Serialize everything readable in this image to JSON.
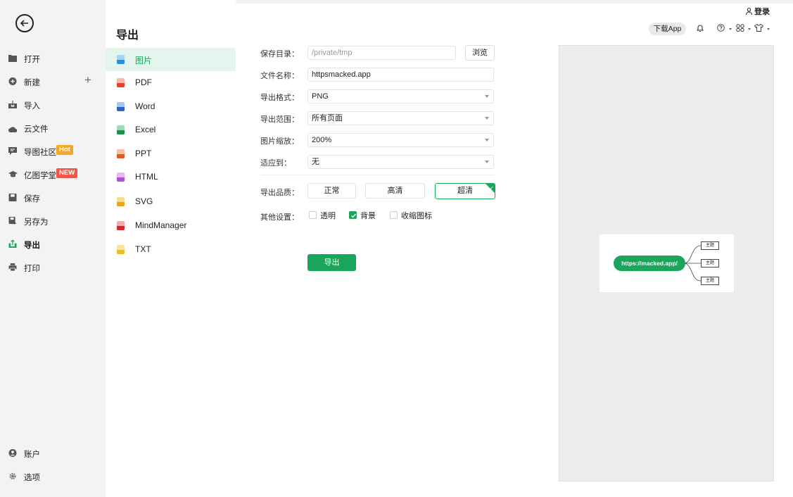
{
  "sidebar": {
    "items": [
      {
        "label": "打开"
      },
      {
        "label": "新建"
      },
      {
        "label": "导入"
      },
      {
        "label": "云文件"
      },
      {
        "label": "导图社区",
        "badge": "Hot"
      },
      {
        "label": "亿图学堂",
        "badge": "NEW"
      },
      {
        "label": "保存"
      },
      {
        "label": "另存为"
      },
      {
        "label": "导出"
      },
      {
        "label": "打印"
      }
    ],
    "bottom": [
      {
        "label": "账户"
      },
      {
        "label": "选项"
      }
    ]
  },
  "export_panel": {
    "title": "导出",
    "formats": [
      "图片",
      "PDF",
      "Word",
      "Excel",
      "PPT",
      "HTML",
      "SVG",
      "MindManager",
      "TXT"
    ],
    "active_format": "图片"
  },
  "form": {
    "save_dir_label": "保存目录：",
    "save_dir_value": "/private/tmp",
    "browse_label": "浏览",
    "filename_label": "文件名称：",
    "filename_value": "httpsmacked.app",
    "format_label": "导出格式：",
    "format_value": "PNG",
    "range_label": "导出范围：",
    "range_value": "所有页面",
    "scale_label": "图片缩放：",
    "scale_value": "200%",
    "fit_label": "适应到：",
    "fit_value": "无",
    "quality_label": "导出品质：",
    "quality_options": [
      "正常",
      "高清",
      "超清"
    ],
    "quality_selected": "超清",
    "other_label": "其他设置：",
    "options": [
      {
        "label": "透明",
        "checked": false
      },
      {
        "label": "背景",
        "checked": true
      },
      {
        "label": "收缩图标",
        "checked": false
      }
    ],
    "export_button": "导出"
  },
  "topbar": {
    "login": "登录",
    "download_app": "下载App"
  },
  "preview": {
    "root": "https://macked.app/",
    "children": [
      "主题",
      "主题",
      "主题"
    ]
  },
  "colors": {
    "accent": "#1aa55a",
    "hot": "#f5a623",
    "new": "#f0564a"
  }
}
